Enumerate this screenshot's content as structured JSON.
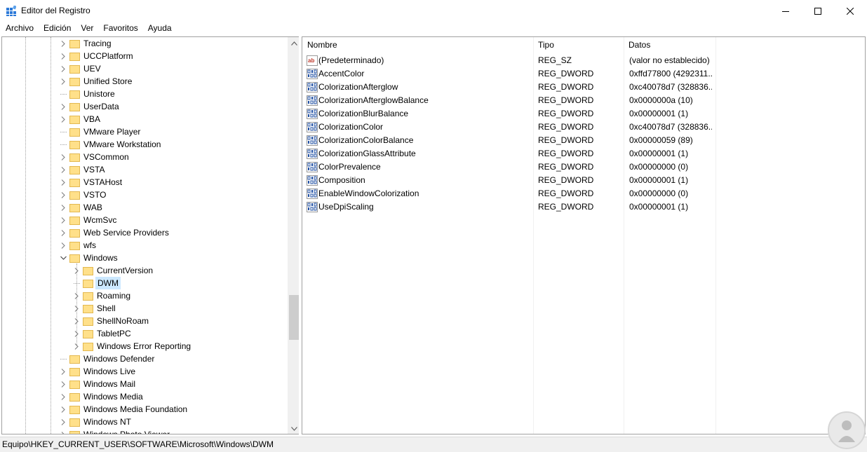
{
  "window": {
    "title": "Editor del Registro"
  },
  "menu": [
    "Archivo",
    "Edición",
    "Ver",
    "Favoritos",
    "Ayuda"
  ],
  "tree": {
    "items": [
      {
        "label": "Tracing",
        "level": 1,
        "expander": "collapsed"
      },
      {
        "label": "UCCPlatform",
        "level": 1,
        "expander": "collapsed"
      },
      {
        "label": "UEV",
        "level": 1,
        "expander": "collapsed"
      },
      {
        "label": "Unified Store",
        "level": 1,
        "expander": "collapsed"
      },
      {
        "label": "Unistore",
        "level": 1,
        "expander": "none"
      },
      {
        "label": "UserData",
        "level": 1,
        "expander": "collapsed"
      },
      {
        "label": "VBA",
        "level": 1,
        "expander": "collapsed"
      },
      {
        "label": "VMware Player",
        "level": 1,
        "expander": "none"
      },
      {
        "label": "VMware Workstation",
        "level": 1,
        "expander": "none"
      },
      {
        "label": "VSCommon",
        "level": 1,
        "expander": "collapsed"
      },
      {
        "label": "VSTA",
        "level": 1,
        "expander": "collapsed"
      },
      {
        "label": "VSTAHost",
        "level": 1,
        "expander": "collapsed"
      },
      {
        "label": "VSTO",
        "level": 1,
        "expander": "collapsed"
      },
      {
        "label": "WAB",
        "level": 1,
        "expander": "collapsed"
      },
      {
        "label": "WcmSvc",
        "level": 1,
        "expander": "collapsed"
      },
      {
        "label": "Web Service Providers",
        "level": 1,
        "expander": "collapsed"
      },
      {
        "label": "wfs",
        "level": 1,
        "expander": "collapsed"
      },
      {
        "label": "Windows",
        "level": 1,
        "expander": "expanded"
      },
      {
        "label": "CurrentVersion",
        "level": 2,
        "expander": "collapsed"
      },
      {
        "label": "DWM",
        "level": 2,
        "expander": "none",
        "selected": true
      },
      {
        "label": "Roaming",
        "level": 2,
        "expander": "collapsed"
      },
      {
        "label": "Shell",
        "level": 2,
        "expander": "collapsed"
      },
      {
        "label": "ShellNoRoam",
        "level": 2,
        "expander": "collapsed"
      },
      {
        "label": "TabletPC",
        "level": 2,
        "expander": "collapsed"
      },
      {
        "label": "Windows Error Reporting",
        "level": 2,
        "expander": "collapsed"
      },
      {
        "label": "Windows Defender",
        "level": 1,
        "expander": "none"
      },
      {
        "label": "Windows Live",
        "level": 1,
        "expander": "collapsed"
      },
      {
        "label": "Windows Mail",
        "level": 1,
        "expander": "collapsed"
      },
      {
        "label": "Windows Media",
        "level": 1,
        "expander": "collapsed"
      },
      {
        "label": "Windows Media Foundation",
        "level": 1,
        "expander": "collapsed"
      },
      {
        "label": "Windows NT",
        "level": 1,
        "expander": "collapsed"
      },
      {
        "label": "Windows Photo Viewer",
        "level": 1,
        "expander": "collapsed"
      }
    ]
  },
  "list": {
    "columns": [
      "Nombre",
      "Tipo",
      "Datos"
    ],
    "rows": [
      {
        "icon": "string-value-icon",
        "name": "(Predeterminado)",
        "type": "REG_SZ",
        "data": "(valor no establecido)"
      },
      {
        "icon": "binary-value-icon",
        "name": "AccentColor",
        "type": "REG_DWORD",
        "data": "0xffd77800 (4292311..."
      },
      {
        "icon": "binary-value-icon",
        "name": "ColorizationAfterglow",
        "type": "REG_DWORD",
        "data": "0xc40078d7 (328836..."
      },
      {
        "icon": "binary-value-icon",
        "name": "ColorizationAfterglowBalance",
        "type": "REG_DWORD",
        "data": "0x0000000a (10)"
      },
      {
        "icon": "binary-value-icon",
        "name": "ColorizationBlurBalance",
        "type": "REG_DWORD",
        "data": "0x00000001 (1)"
      },
      {
        "icon": "binary-value-icon",
        "name": "ColorizationColor",
        "type": "REG_DWORD",
        "data": "0xc40078d7 (328836..."
      },
      {
        "icon": "binary-value-icon",
        "name": "ColorizationColorBalance",
        "type": "REG_DWORD",
        "data": "0x00000059 (89)"
      },
      {
        "icon": "binary-value-icon",
        "name": "ColorizationGlassAttribute",
        "type": "REG_DWORD",
        "data": "0x00000001 (1)"
      },
      {
        "icon": "binary-value-icon",
        "name": "ColorPrevalence",
        "type": "REG_DWORD",
        "data": "0x00000000 (0)"
      },
      {
        "icon": "binary-value-icon",
        "name": "Composition",
        "type": "REG_DWORD",
        "data": "0x00000001 (1)"
      },
      {
        "icon": "binary-value-icon",
        "name": "EnableWindowColorization",
        "type": "REG_DWORD",
        "data": "0x00000000 (0)"
      },
      {
        "icon": "binary-value-icon",
        "name": "UseDpiScaling",
        "type": "REG_DWORD",
        "data": "0x00000001 (1)"
      }
    ]
  },
  "status": {
    "path": "Equipo\\HKEY_CURRENT_USER\\SOFTWARE\\Microsoft\\Windows\\DWM"
  },
  "colors": {
    "selection": "#cce8ff",
    "folder": "#ffe08a",
    "string_icon": "#c0392b",
    "binary_icon": "#1f4fa3"
  }
}
